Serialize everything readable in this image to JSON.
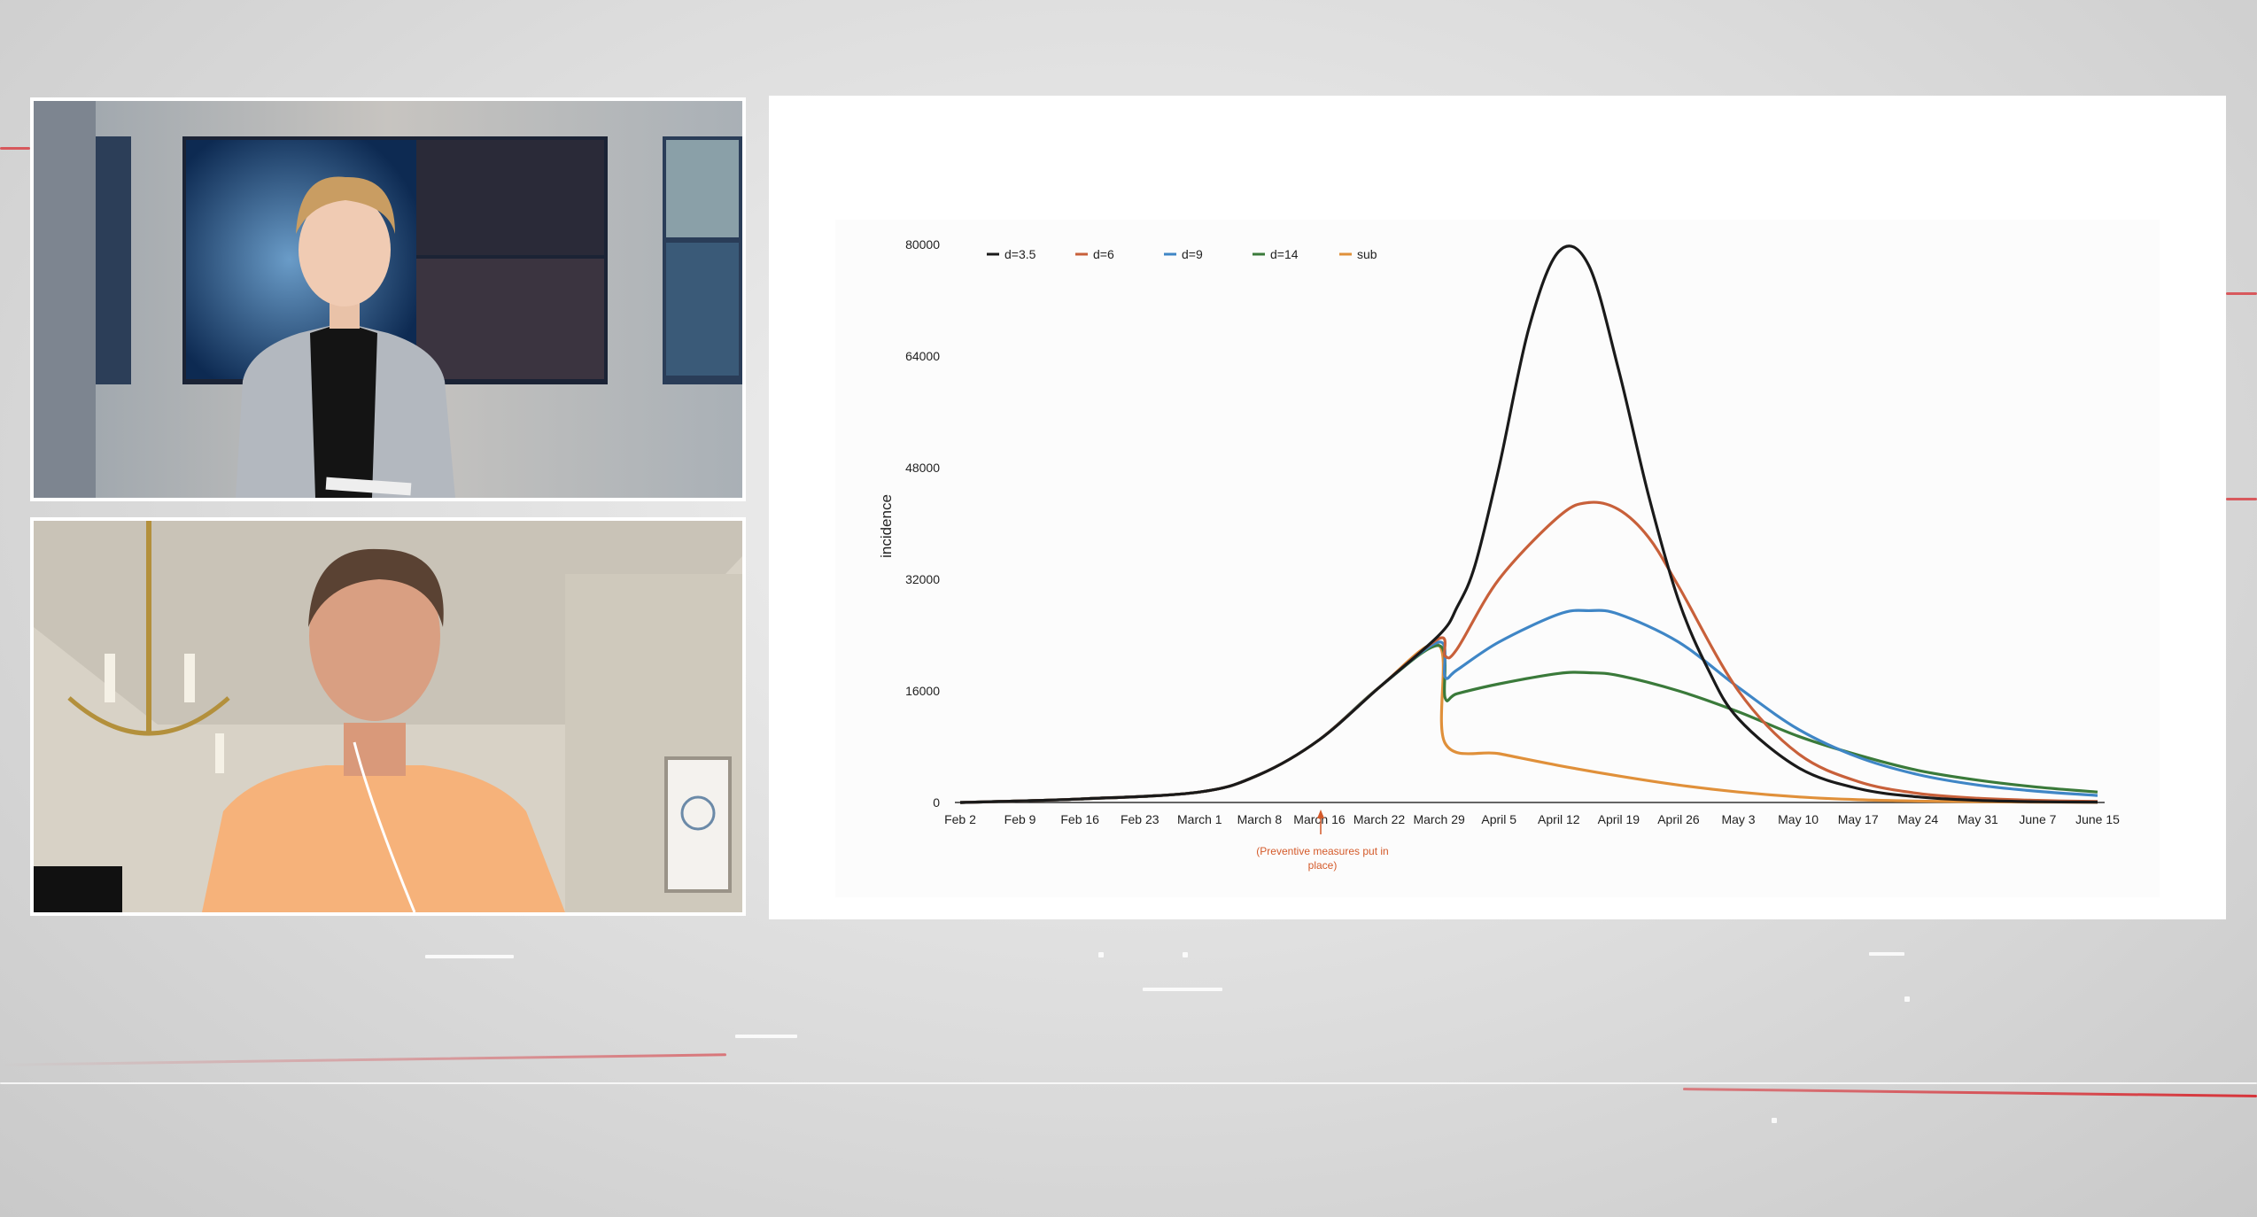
{
  "colors": {
    "broadcast_red": "#d8232a",
    "d3_5": "#1a1a1a",
    "d6": "#c8603a",
    "d9": "#3f86c6",
    "d14": "#3a7a3a",
    "sub": "#e0903a",
    "annotation": "#d45a2a"
  },
  "video_panels": {
    "anchor": {
      "icon": "news-anchor-person"
    },
    "guest": {
      "icon": "remote-guest-person"
    }
  },
  "chart_data": {
    "type": "line",
    "title": "",
    "xlabel": "",
    "ylabel": "incidence",
    "ylim": [
      0,
      80000
    ],
    "yticks": [
      "0",
      "16000",
      "32000",
      "48000",
      "64000",
      "80000"
    ],
    "x_tick_labels": [
      "Feb 2",
      "Feb 9",
      "Feb 16",
      "Feb 23",
      "March 1",
      "March 8",
      "March 16",
      "March 22",
      "March 29",
      "April 5",
      "April 12",
      "April 19",
      "April 26",
      "May 3",
      "May 10",
      "May 17",
      "May 24",
      "May 31",
      "June 7",
      "June 15"
    ],
    "legend_position": "top-left",
    "annotation": {
      "text_line1": "(Preventive measures put in",
      "text_line2": "place)",
      "at_tick": "March 16"
    },
    "series": [
      {
        "name": "d=3.5",
        "color": "#1a1a1a",
        "x": [
          0,
          2,
          4,
          5,
          6,
          7,
          8,
          8.3,
          8.6,
          9,
          9.5,
          10,
          10.5,
          11,
          11.5,
          12,
          12.5,
          13,
          14,
          15,
          16,
          17,
          18,
          19
        ],
        "values": [
          0,
          500,
          1500,
          4000,
          9000,
          16500,
          24000,
          28000,
          34000,
          48000,
          68000,
          79000,
          77000,
          62000,
          44000,
          29000,
          19000,
          12000,
          5000,
          2000,
          800,
          300,
          100,
          50
        ]
      },
      {
        "name": "d=6",
        "color": "#c8603a",
        "x": [
          0,
          2,
          4,
          5,
          6,
          7,
          8,
          8.1,
          8.3,
          9,
          10,
          10.5,
          11,
          11.5,
          12,
          13,
          14,
          15,
          16,
          17,
          18,
          19
        ],
        "values": [
          0,
          500,
          1500,
          4000,
          9000,
          16500,
          23500,
          21000,
          22000,
          32000,
          41000,
          43000,
          42000,
          38000,
          31000,
          16000,
          7000,
          3000,
          1300,
          600,
          300,
          150
        ]
      },
      {
        "name": "d=9",
        "color": "#3f86c6",
        "x": [
          0,
          2,
          4,
          5,
          6,
          7,
          8,
          8.1,
          8.3,
          9,
          10,
          10.5,
          11,
          12,
          13,
          14,
          15,
          16,
          17,
          18,
          19
        ],
        "values": [
          0,
          500,
          1500,
          4000,
          9000,
          16500,
          23000,
          18000,
          19000,
          23000,
          27000,
          27500,
          27000,
          23000,
          16500,
          10500,
          6500,
          4000,
          2500,
          1600,
          1000
        ]
      },
      {
        "name": "d=14",
        "color": "#3a7a3a",
        "x": [
          0,
          2,
          4,
          5,
          6,
          7,
          8,
          8.1,
          8.3,
          9,
          10,
          10.5,
          11,
          12,
          13,
          14,
          15,
          16,
          17,
          18,
          19
        ],
        "values": [
          0,
          500,
          1500,
          4000,
          9000,
          16500,
          22500,
          15000,
          15600,
          17000,
          18500,
          18600,
          18200,
          16000,
          13000,
          9500,
          6800,
          4600,
          3200,
          2200,
          1500
        ]
      },
      {
        "name": "sub",
        "color": "#e0903a",
        "x": [
          0,
          2,
          4,
          5,
          6,
          7,
          8,
          8.1,
          9,
          10,
          11,
          12,
          13,
          14,
          15,
          16,
          17,
          18,
          19
        ],
        "values": [
          0,
          500,
          1500,
          4000,
          9000,
          16500,
          22500,
          8500,
          7000,
          5300,
          3800,
          2500,
          1500,
          800,
          400,
          200,
          100,
          50,
          20
        ]
      }
    ]
  }
}
